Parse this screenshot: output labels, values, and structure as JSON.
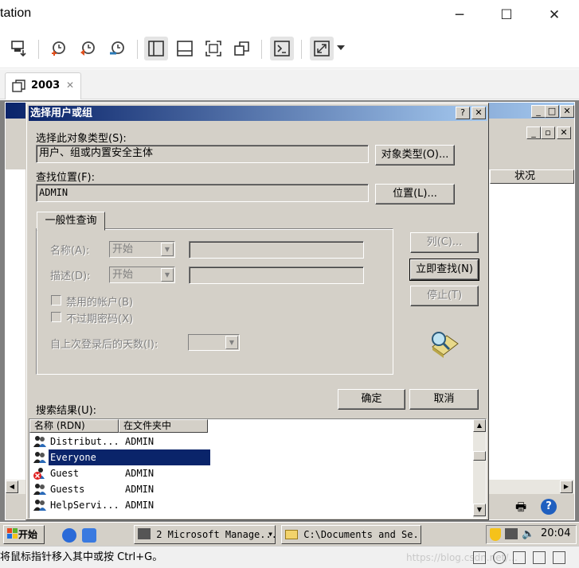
{
  "host": {
    "title_fragment": "tation",
    "window_controls": {
      "minimize": "─",
      "maximize": "☐",
      "close": "✕"
    },
    "tab": {
      "label": "2003",
      "close": "✕"
    },
    "status_text": "将鼠标指针移入其中或按 Ctrl+G。",
    "watermark": "https://blog.csdn.net/..."
  },
  "mmc": {
    "column_status": "状况"
  },
  "dialog": {
    "title": "选择用户或组",
    "help_btn": "?",
    "close_btn": "✕",
    "object_type_label": "选择此对象类型(S):",
    "object_type_value": "用户、组或内置安全主体",
    "object_type_btn": "对象类型(O)...",
    "location_label": "查找位置(F):",
    "location_value": "ADMIN",
    "location_btn": "位置(L)...",
    "query_tab": "一般性查询",
    "name_label": "名称(A):",
    "name_mode": "开始",
    "desc_label": "描述(D):",
    "desc_mode": "开始",
    "disabled_accounts": "禁用的帐户(B)",
    "no_expire_pwd": "不过期密码(X)",
    "days_since_login": "自上次登录后的天数(I):",
    "columns_btn": "列(C)...",
    "find_now_btn": "立即查找(N)",
    "stop_btn": "停止(T)",
    "ok_btn": "确定",
    "cancel_btn": "取消",
    "results_label": "搜索结果(U):",
    "results_headers": [
      "名称 (RDN)",
      "在文件夹中"
    ],
    "results": [
      {
        "name": "Distribut...",
        "folder": "ADMIN",
        "selected": false
      },
      {
        "name": "Everyone",
        "folder": "",
        "selected": true
      },
      {
        "name": "Guest",
        "folder": "ADMIN",
        "selected": false
      },
      {
        "name": "Guests",
        "folder": "ADMIN",
        "selected": false
      },
      {
        "name": "HelpServi...",
        "folder": "ADMIN",
        "selected": false
      }
    ]
  },
  "taskbar": {
    "start": "开始",
    "task1": "2 Microsoft Manage...",
    "task2": "C:\\Documents and Se...",
    "clock": "20:04"
  },
  "colors": {
    "title_gradient_start": "#0a246a",
    "title_gradient_end": "#a6caf0",
    "selection": "#0a246a",
    "classic_face": "#d4d0c8"
  }
}
